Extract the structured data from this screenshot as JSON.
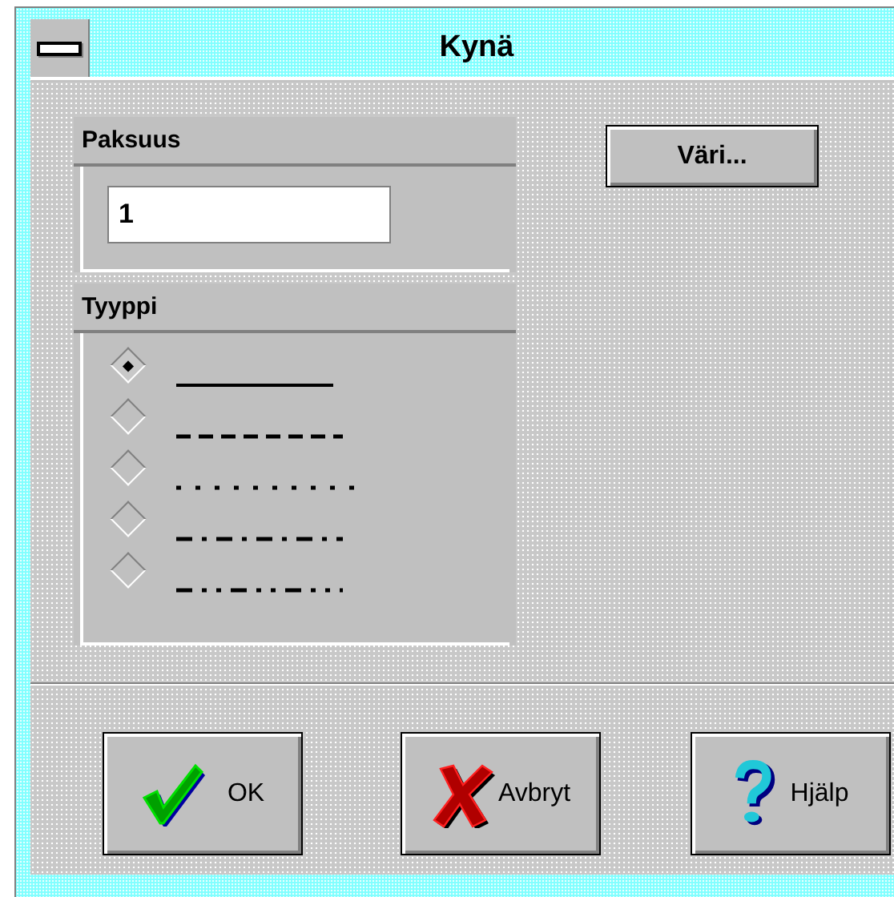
{
  "window": {
    "title": "Kynä"
  },
  "thickness": {
    "label": "Paksuus",
    "value": "1"
  },
  "color_button": "Väri...",
  "line_type": {
    "label": "Tyyppi",
    "options": [
      {
        "kind": "solid",
        "selected": true
      },
      {
        "kind": "dash",
        "selected": false
      },
      {
        "kind": "dot",
        "selected": false
      },
      {
        "kind": "dashdot",
        "selected": false
      },
      {
        "kind": "dashdotdot",
        "selected": false
      }
    ]
  },
  "buttons": [
    {
      "kind": "ok",
      "label": "OK"
    },
    {
      "kind": "cancel",
      "label": "Avbryt"
    },
    {
      "kind": "help",
      "label": "Hjälp"
    }
  ]
}
